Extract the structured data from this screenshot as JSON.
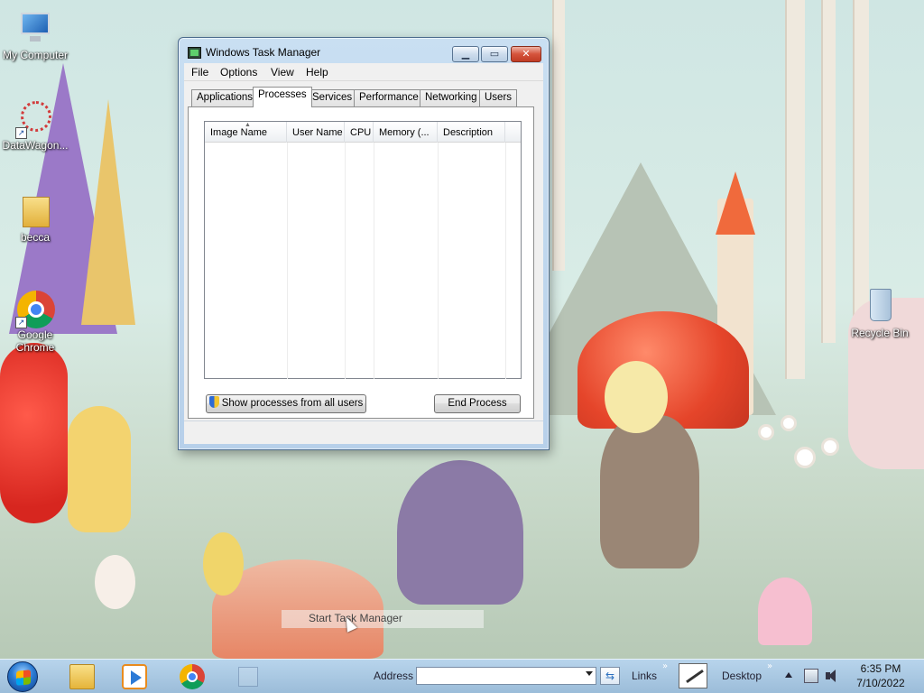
{
  "desktop": {
    "icons": [
      {
        "label": "My Computer"
      },
      {
        "label": "DataWagon..."
      },
      {
        "label": "becca"
      },
      {
        "label": "Google Chrome"
      },
      {
        "label": "Recycle Bin"
      }
    ]
  },
  "task_manager": {
    "title": "Windows Task Manager",
    "menu": [
      "File",
      "Options",
      "View",
      "Help"
    ],
    "tabs": [
      "Applications",
      "Processes",
      "Services",
      "Performance",
      "Networking",
      "Users"
    ],
    "active_tab": "Processes",
    "columns": [
      "Image Name",
      "User Name",
      "CPU",
      "Memory (...",
      "Description"
    ],
    "rows": [],
    "show_all_button": "Show processes from all users",
    "end_process_button": "End Process"
  },
  "tooltip": {
    "text": "Start Task Manager"
  },
  "taskbar": {
    "address_label": "Address",
    "address_value": "",
    "links_label": "Links",
    "desktop_label": "Desktop",
    "clock_time": "6:35 PM",
    "clock_date": "7/10/2022"
  },
  "colors": {
    "taskbar": "#9fbfdc",
    "window_frame": "#c1d7ee",
    "close_button": "#c8452e"
  }
}
